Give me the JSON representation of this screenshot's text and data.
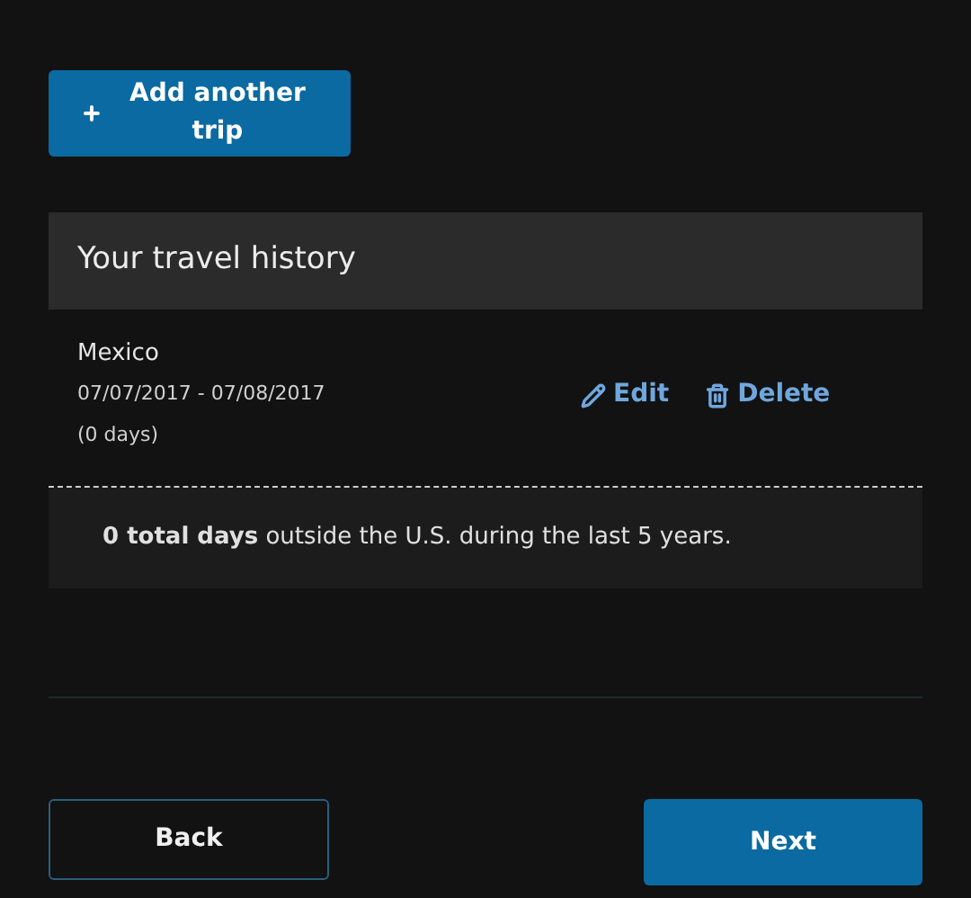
{
  "add_button": {
    "label": "Add another trip"
  },
  "history": {
    "title": "Your travel history",
    "trips": [
      {
        "country": "Mexico",
        "dates": "07/07/2017 - 07/08/2017 (0 days)",
        "edit": "Edit",
        "delete": "Delete"
      }
    ],
    "total": "**0 total days** outside the U.S. during the last 5 years."
  },
  "buttons": [
    {
      "label": "Back",
      "kind": "secondary"
    },
    {
      "label": "Next",
      "kind": "primary"
    }
  ]
}
